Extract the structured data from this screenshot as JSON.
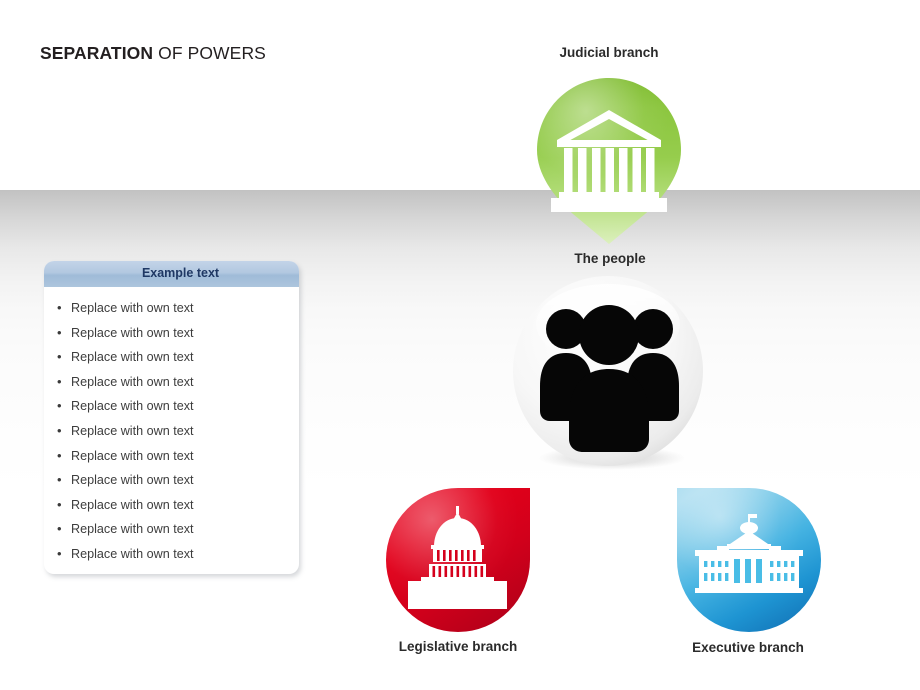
{
  "title": {
    "bold_part": "SEPARATION",
    "normal_part": " OF POWERS"
  },
  "example_panel": {
    "header_label": "Example text",
    "bullets": [
      "Replace with own text",
      "Replace with own text",
      "Replace with own text",
      "Replace with own text",
      "Replace with own text",
      "Replace with own text",
      "Replace with own text",
      "Replace with own text",
      "Replace with own text",
      "Replace with own text",
      "Replace with own text"
    ],
    "bullet_marker": "•",
    "header_bg_color": "#b2c8e0",
    "header_text_color": "#1f3864"
  },
  "diagram": {
    "nodes": [
      {
        "key": "judicial",
        "label": "Judicial branch",
        "icon": "courthouse-icon",
        "shape": "map-pin",
        "color": "#8dc63f"
      },
      {
        "key": "people",
        "label": "The people",
        "icon": "people-group-icon",
        "shape": "sphere",
        "color": "#f2f2f2"
      },
      {
        "key": "legislative",
        "label": "Legislative branch",
        "icon": "capitol-building-icon",
        "shape": "teardrop-top-right",
        "color": "#e2001a"
      },
      {
        "key": "executive",
        "label": "Executive branch",
        "icon": "white-house-icon",
        "shape": "teardrop-top-left",
        "color": "#29a3dc"
      }
    ]
  }
}
